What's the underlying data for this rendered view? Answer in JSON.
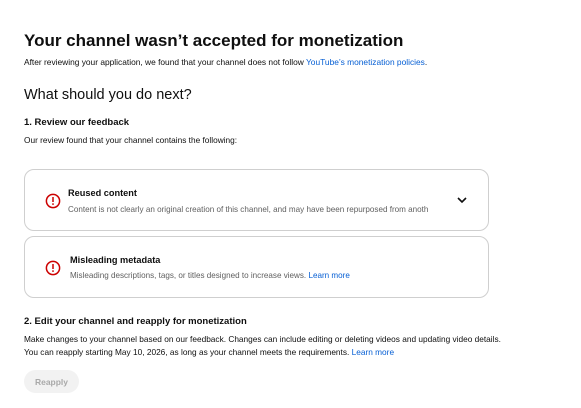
{
  "header": {
    "title": "Your channel wasn’t accepted for monetization",
    "subtitle_prefix": "After reviewing your application, we found that your channel does not follow ",
    "subtitle_link": "YouTube’s monetization policies",
    "subtitle_suffix": "."
  },
  "next_steps_heading": "What should you do next?",
  "step1": {
    "title": "1. Review our feedback",
    "description": "Our review found that your channel contains the following:"
  },
  "issues": [
    {
      "icon": "alert-circle-icon",
      "title": "Reused content",
      "description": "Content is not clearly an original creation of this channel, and may have been repurposed from anoth",
      "expand_icon": "chevron-down-icon"
    },
    {
      "icon": "alert-circle-icon",
      "title": "Misleading metadata",
      "description": "Misleading descriptions, tags, or titles designed to increase views. ",
      "link": "Learn more"
    }
  ],
  "step2": {
    "title": "2. Edit your channel and reapply for monetization",
    "description": "Make changes to your channel based on our feedback. Changes can include editing or deleting videos and updating video details. You can reapply starting May 10, 2026, as long as your channel meets the requirements. ",
    "link": "Learn more"
  },
  "reapply_button": {
    "label": "Reapply",
    "disabled": true
  },
  "colors": {
    "link": "#065fd4",
    "alert": "#cc0000",
    "border": "#cfcfcf",
    "muted_text": "#606060"
  }
}
